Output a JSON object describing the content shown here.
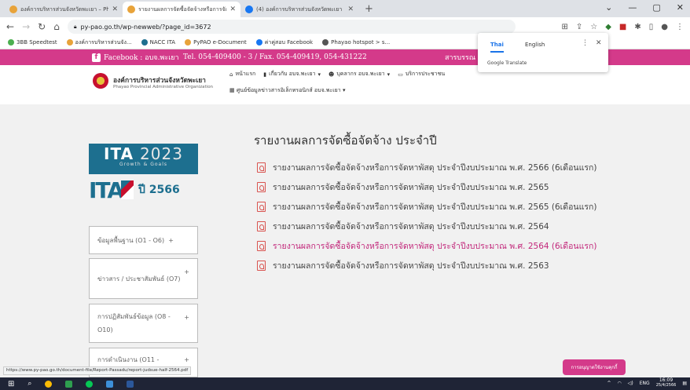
{
  "browser": {
    "tabs": [
      {
        "title": "องค์การบริหารส่วนจังหวัดพะเยา – Pho",
        "active": false
      },
      {
        "title": "รายงานผลการจัดซื้อจัดจ้างหรือการจัด",
        "active": true
      },
      {
        "title": "(4) องค์การบริหารส่วนจังหวัดพะเยา |",
        "active": false
      }
    ],
    "url": "py-pao.go.th/wp-newweb/?page_id=3672",
    "bookmarks": [
      "3BB Speedtest",
      "องค์การบริหารส่วนจัง...",
      "NACC ITA",
      "PyPAO e-Document",
      "ค่าคู่สอบ Facebook",
      "Phayao hotspot > s..."
    ]
  },
  "translate_popup": {
    "tab_thai": "Thai",
    "tab_english": "English",
    "footer": "Google Translate"
  },
  "topbar": {
    "facebook": "Facebook : อบจ.พะเยา",
    "phone": "Tel. 054-409400 - 3 / Fax. 054-409419, 054-431222",
    "library": "สารบรรณ"
  },
  "header": {
    "org_name": "องค์การบริหารส่วนจังหวัดพะเยา",
    "org_sub": "Phayao Provincial Administrative Organization",
    "nav": [
      "หน้าแรก",
      "เกี่ยวกับ อบจ.พะเยา",
      "บุคลากร อบจ.พะเยา",
      "บริการประชาชน"
    ],
    "nav2": "ศูนย์ข้อมูลข่าวสารอิเล็กทรอนิกส์ อบจ.พะเยา"
  },
  "sidebar": {
    "ita_title": "ITA",
    "ita_year": "2023",
    "ita_tagline": "Growth & Goals",
    "ita2_year": "ปี 2566",
    "items": [
      "ข้อมูลพื้นฐาน (O1 - O6)",
      "ข่าวสาร / ประชาสัมพันธ์ (O7)",
      "การปฏิสัมพันธ์ข้อมูล (O8 - O10)",
      "การดำเนินงาน (O11 -"
    ]
  },
  "main": {
    "title": "รายงานผลการจัดซื้อจัดจ้าง ประจำปี",
    "reports": [
      "รายงานผลการจัดซื้อจัดจ้างหรือการจัดหาพัสดุ ประจำปีงบประมาณ พ.ศ. 2566 (6เดือนแรก)",
      "รายงานผลการจัดซื้อจัดจ้างหรือการจัดหาพัสดุ ประจำปีงบประมาณ พ.ศ. 2565",
      "รายงานผลการจัดซื้อจัดจ้างหรือการจัดหาพัสดุ ประจำปีงบประมาณ พ.ศ. 2565 (6เดือนแรก)",
      "รายงานผลการจัดซื้อจัดจ้างหรือการจัดหาพัสดุ ประจำปีงบประมาณ พ.ศ. 2564",
      "รายงานผลการจัดซื้อจัดจ้างหรือการจัดหาพัสดุ ประจำปีงบประมาณ พ.ศ. 2564 (6เดือนแรก)",
      "รายงานผลการจัดซื้อจัดจ้างหรือการจัดหาพัสดุ ประจำปีงบประมาณ พ.ศ. 2563"
    ]
  },
  "status_url": "https://www.py-pao.go.th/document-file/Report-Passadu/report-judsue-half-2564.pdf",
  "cookie_button": "การอนุญาตใช้งานคุกกี้",
  "taskbar": {
    "lang": "ENG",
    "time": "16:09",
    "date": "25/4/2566"
  },
  "colors": {
    "brand_pink": "#d43a8a",
    "ita_blue": "#1d6f8f",
    "link_highlight": "#c2267a"
  }
}
